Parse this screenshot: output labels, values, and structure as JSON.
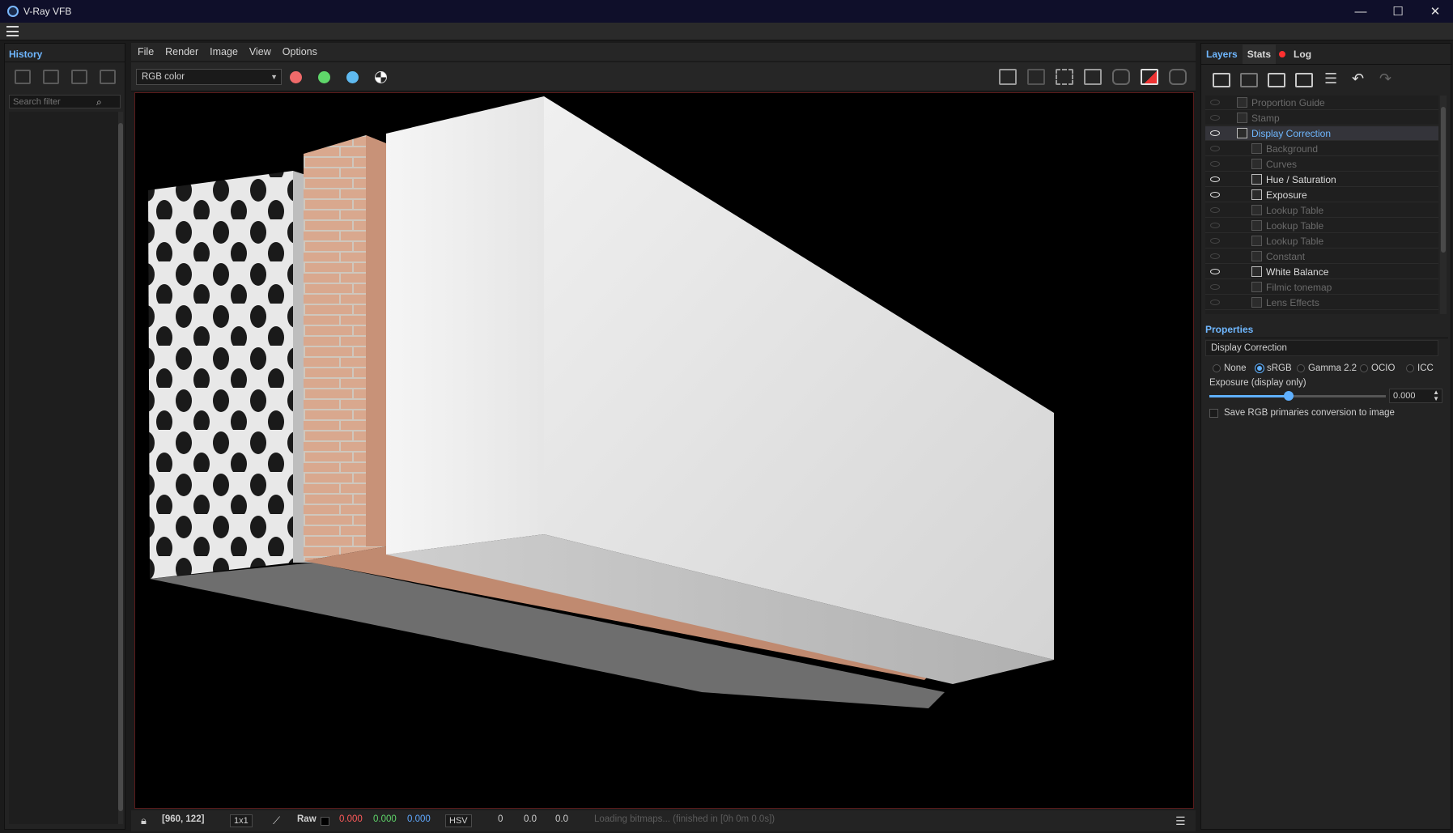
{
  "window": {
    "title": "V-Ray VFB",
    "controls": {
      "minimize": "—",
      "maximize": "☐",
      "close": "✕"
    }
  },
  "history": {
    "tab": "History",
    "search_placeholder": "Search filter"
  },
  "menu": [
    "File",
    "Render",
    "Image",
    "View",
    "Options"
  ],
  "toolbar": {
    "channel": "RGB color",
    "channel_dots": {
      "red": "#f06a6a",
      "green": "#5fd66a",
      "blue": "#5fbaf0"
    }
  },
  "status": {
    "coords": "[960, 122]",
    "zoom": "1x1",
    "mode": "Raw",
    "r": "0.000",
    "g": "0.000",
    "b": "0.000",
    "colorspace": "HSV",
    "h": "0",
    "s": "0.0",
    "v": "0.0",
    "message": "Loading bitmaps... (finished in [0h  0m  0.0s])"
  },
  "right": {
    "tabs": {
      "layers": "Layers",
      "stats": "Stats",
      "log": "Log"
    },
    "layers": [
      {
        "name": "Proportion Guide",
        "visible": false,
        "indent": 0
      },
      {
        "name": "Stamp",
        "visible": false,
        "indent": 0
      },
      {
        "name": "Display Correction",
        "visible": true,
        "indent": 0,
        "selected": true
      },
      {
        "name": "Background",
        "visible": false,
        "indent": 1
      },
      {
        "name": "Curves",
        "visible": false,
        "indent": 1
      },
      {
        "name": "Hue / Saturation",
        "visible": true,
        "indent": 1
      },
      {
        "name": "Exposure",
        "visible": true,
        "indent": 1
      },
      {
        "name": "Lookup Table",
        "visible": false,
        "indent": 1
      },
      {
        "name": "Lookup Table",
        "visible": false,
        "indent": 1
      },
      {
        "name": "Lookup Table",
        "visible": false,
        "indent": 1
      },
      {
        "name": "Constant",
        "visible": false,
        "indent": 1
      },
      {
        "name": "White Balance",
        "visible": true,
        "indent": 1
      },
      {
        "name": "Filmic tonemap",
        "visible": false,
        "indent": 1
      },
      {
        "name": "Lens Effects",
        "visible": false,
        "indent": 1
      }
    ],
    "properties": {
      "title": "Properties",
      "name": "Display Correction",
      "options": [
        "None",
        "sRGB",
        "Gamma 2.2",
        "OCIO",
        "ICC"
      ],
      "selected_option": "sRGB",
      "exposure_label": "Exposure (display only)",
      "exposure_value": "0.000",
      "exposure_slider_fraction": 0.45,
      "save_label": "Save RGB primaries conversion to image"
    }
  }
}
